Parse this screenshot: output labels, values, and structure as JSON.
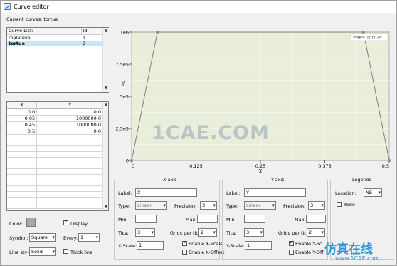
{
  "window": {
    "title": "Curve editor"
  },
  "current_curves": "Current curves: tortue",
  "curve_list": {
    "headers": [
      "Curve List:",
      "Id"
    ],
    "rows": [
      {
        "name": "roalateve",
        "id": "1"
      },
      {
        "name": "tortue",
        "id": "2"
      }
    ]
  },
  "data_table": {
    "headers": [
      "X",
      "Y"
    ],
    "rows": [
      [
        "0.0",
        "0.0"
      ],
      [
        "0.05",
        "1000000.0"
      ],
      [
        "0.45",
        "1000000.0"
      ],
      [
        "0.5",
        "0.0"
      ]
    ]
  },
  "display_options": {
    "color_label": "Color:",
    "display_label": "Display",
    "symbol_label": "Symbol:",
    "symbol_value": "Square",
    "every_label": "Every:",
    "every_value": "1",
    "linestyle_label": "Line style:",
    "linestyle_value": "Solid",
    "thick_label": "Thick line"
  },
  "chart_data": {
    "type": "line",
    "series": [
      {
        "name": "tortue",
        "x": [
          0.0,
          0.05,
          0.45,
          0.5
        ],
        "y": [
          0.0,
          1000000.0,
          1000000.0,
          0.0
        ]
      }
    ],
    "xlabel": "X",
    "ylabel": "Y",
    "xlim": [
      0,
      0.5
    ],
    "ylim": [
      0,
      1000000
    ],
    "xticks": [
      "0",
      "0.125",
      "0.25",
      "0.375",
      "0.5"
    ],
    "yticks": [
      "0",
      "2.5e5",
      "5e5",
      "7.5e5",
      "1e6"
    ],
    "legend": "top-right",
    "grid": true
  },
  "x_axis": {
    "title": "X-axis",
    "label_label": "Label:",
    "label_value": "X",
    "type_label": "Type:",
    "type_value": "Linear",
    "precision_label": "Precision:",
    "precision_value": "3",
    "min_label": "Min:",
    "max_label": "Max:",
    "tics_label": "Tics:",
    "tics_value": "3",
    "grids_label": "Grids per tic:",
    "grids_value": "2",
    "scale_label": "X-Scale:",
    "scale_value": "1",
    "enable_scale": "Enable X-Scale",
    "enable_offset": "Enable X-Offset"
  },
  "y_axis": {
    "title": "Y-axis",
    "label_label": "Label:",
    "label_value": "Y",
    "type_label": "Type:",
    "type_value": "Linear",
    "precision_label": "Precision:",
    "precision_value": "3",
    "min_label": "Min:",
    "max_label": "Max:",
    "tics_label": "Tics:",
    "tics_value": "3",
    "grids_label": "Grids per tic:",
    "grids_value": "2",
    "scale_label": "Y-Scale:",
    "scale_value": "1",
    "enable_scale": "Enable Y-Sc",
    "enable_offset": "Enable Y-Off"
  },
  "legends": {
    "title": "Legends",
    "location_label": "Location:",
    "location_value": "NE",
    "hide_label": "Hide"
  },
  "watermark": {
    "center": "1CAE.COM",
    "cn": "仿真在线",
    "url": "www.1CAE.com"
  }
}
